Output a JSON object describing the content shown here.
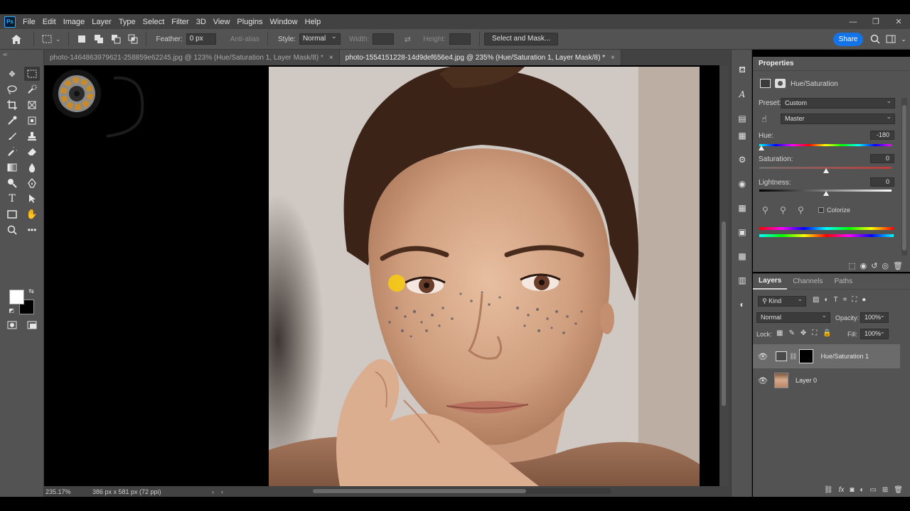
{
  "app": {
    "logo_text": "Ps"
  },
  "menu": [
    "File",
    "Edit",
    "Image",
    "Layer",
    "Type",
    "Select",
    "Filter",
    "3D",
    "View",
    "Plugins",
    "Window",
    "Help"
  ],
  "options": {
    "feather_label": "Feather:",
    "feather_value": "0 px",
    "antialias_label": "Anti-alias",
    "style_label": "Style:",
    "style_value": "Normal",
    "width_label": "Width:",
    "height_label": "Height:",
    "select_mask_label": "Select and Mask...",
    "share_label": "Share"
  },
  "tabs": [
    {
      "label": "photo-1464863979621-258859e62245.jpg @ 123% (Hue/Saturation 1, Layer Mask/8) *",
      "close": "×",
      "active": false
    },
    {
      "label": "photo-1554151228-14d9def656e4.jpg @ 235% (Hue/Saturation 1, Layer Mask/8) *",
      "close": "×",
      "active": true
    }
  ],
  "status": {
    "zoom": "235.17%",
    "doc_info": "386 px x 581 px (72 ppi)"
  },
  "properties": {
    "title": "Properties",
    "adjustment_name": "Hue/Saturation",
    "preset_label": "Preset:",
    "preset_value": "Custom",
    "channel_value": "Master",
    "hue_label": "Hue:",
    "hue_value": "-180",
    "saturation_label": "Saturation:",
    "saturation_value": "0",
    "lightness_label": "Lightness:",
    "lightness_value": "0",
    "colorize_label": "Colorize",
    "hue_slider_fraction": 0.0,
    "saturation_slider_fraction": 0.5,
    "lightness_slider_fraction": 0.5
  },
  "layers": {
    "tabs": [
      "Layers",
      "Channels",
      "Paths"
    ],
    "kind_label": "Kind",
    "blend_mode": "Normal",
    "opacity_label": "Opacity:",
    "opacity_value": "100%",
    "lock_label": "Lock:",
    "fill_label": "Fill:",
    "fill_value": "100%",
    "items": [
      {
        "name": "Hue/Saturation 1",
        "selected": true
      },
      {
        "name": "Layer 0",
        "selected": false
      }
    ]
  },
  "colors": {
    "accent": "#1473e6",
    "panel": "#535353",
    "chrome": "#424242"
  }
}
